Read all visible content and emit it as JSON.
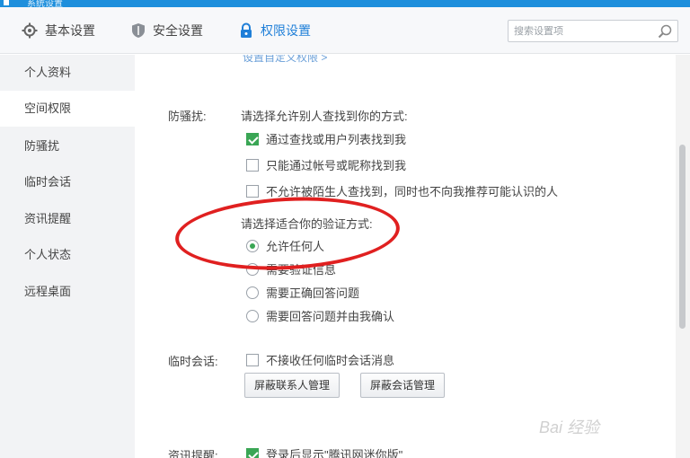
{
  "titlebar": {
    "title": "系统设置"
  },
  "tabs": [
    {
      "label": "基本设置",
      "icon": "gear-icon"
    },
    {
      "label": "安全设置",
      "icon": "shield-icon"
    },
    {
      "label": "权限设置",
      "icon": "lock-icon",
      "active": true
    }
  ],
  "search": {
    "placeholder": "搜索设置项",
    "value": ""
  },
  "sidebar": {
    "items": [
      {
        "label": "个人资料"
      },
      {
        "label": "空间权限",
        "active": true
      },
      {
        "label": "防骚扰"
      },
      {
        "label": "临时会话"
      },
      {
        "label": "资讯提醒"
      },
      {
        "label": "个人状态"
      },
      {
        "label": "远程桌面"
      }
    ]
  },
  "content": {
    "top_link": "设置自定义权限 >",
    "anti_harass": {
      "label": "防骚扰:",
      "prompt": "请选择允许别人查找到你的方式:",
      "options": [
        {
          "label": "通过查找或用户列表找到我",
          "checked": true
        },
        {
          "label": "只能通过帐号或昵称找到我",
          "checked": false
        },
        {
          "label": "不允许被陌生人查找到，同时也不向我推荐可能认识的人",
          "checked": false
        }
      ],
      "verify_prompt": "请选择适合你的验证方式:",
      "verify_options": [
        {
          "label": "允许任何人",
          "checked": true
        },
        {
          "label": "需要验证信息",
          "checked": false
        },
        {
          "label": "需要正确回答问题",
          "checked": false
        },
        {
          "label": "需要回答问题并由我确认",
          "checked": false
        }
      ]
    },
    "temp_session": {
      "label": "临时会话:",
      "option": {
        "label": "不接收任何临时会话消息",
        "checked": false
      },
      "btn_contacts": "屏蔽联系人管理",
      "btn_sessions": "屏蔽会话管理"
    },
    "news": {
      "label": "资讯提醒:",
      "option": {
        "label": "登录后显示\"腾讯网迷你版\"",
        "checked": true
      }
    }
  },
  "watermark": "Bai 经验",
  "colors": {
    "accent": "#1f7fd8",
    "check": "#3aa655",
    "annotation": "#e02020"
  }
}
